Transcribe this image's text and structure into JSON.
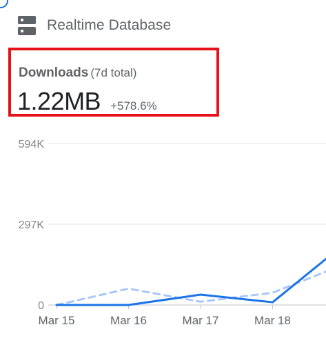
{
  "header": {
    "icon": "database-icon",
    "title": "Realtime Database"
  },
  "metric": {
    "label": "Downloads",
    "sublabel": "(7d total)",
    "value": "1.22MB",
    "change": "+578.6%",
    "highlight_color": "#e8111a"
  },
  "chart_data": {
    "type": "line",
    "categories": [
      "Mar 15",
      "Mar 16",
      "Mar 17",
      "Mar 18",
      ""
    ],
    "ylim": [
      0,
      594000
    ],
    "y_ticks": [
      "594K",
      "297K",
      "0"
    ],
    "y_tick_values": [
      594000,
      297000,
      0
    ],
    "grid": true,
    "series": [
      {
        "style": "solid",
        "color": "#1a73e8",
        "values": [
          0,
          0,
          38000,
          10000,
          225000
        ]
      },
      {
        "style": "dashed",
        "color": "#a8c7fa",
        "values": [
          0,
          60000,
          12000,
          45000,
          150000
        ]
      }
    ]
  }
}
